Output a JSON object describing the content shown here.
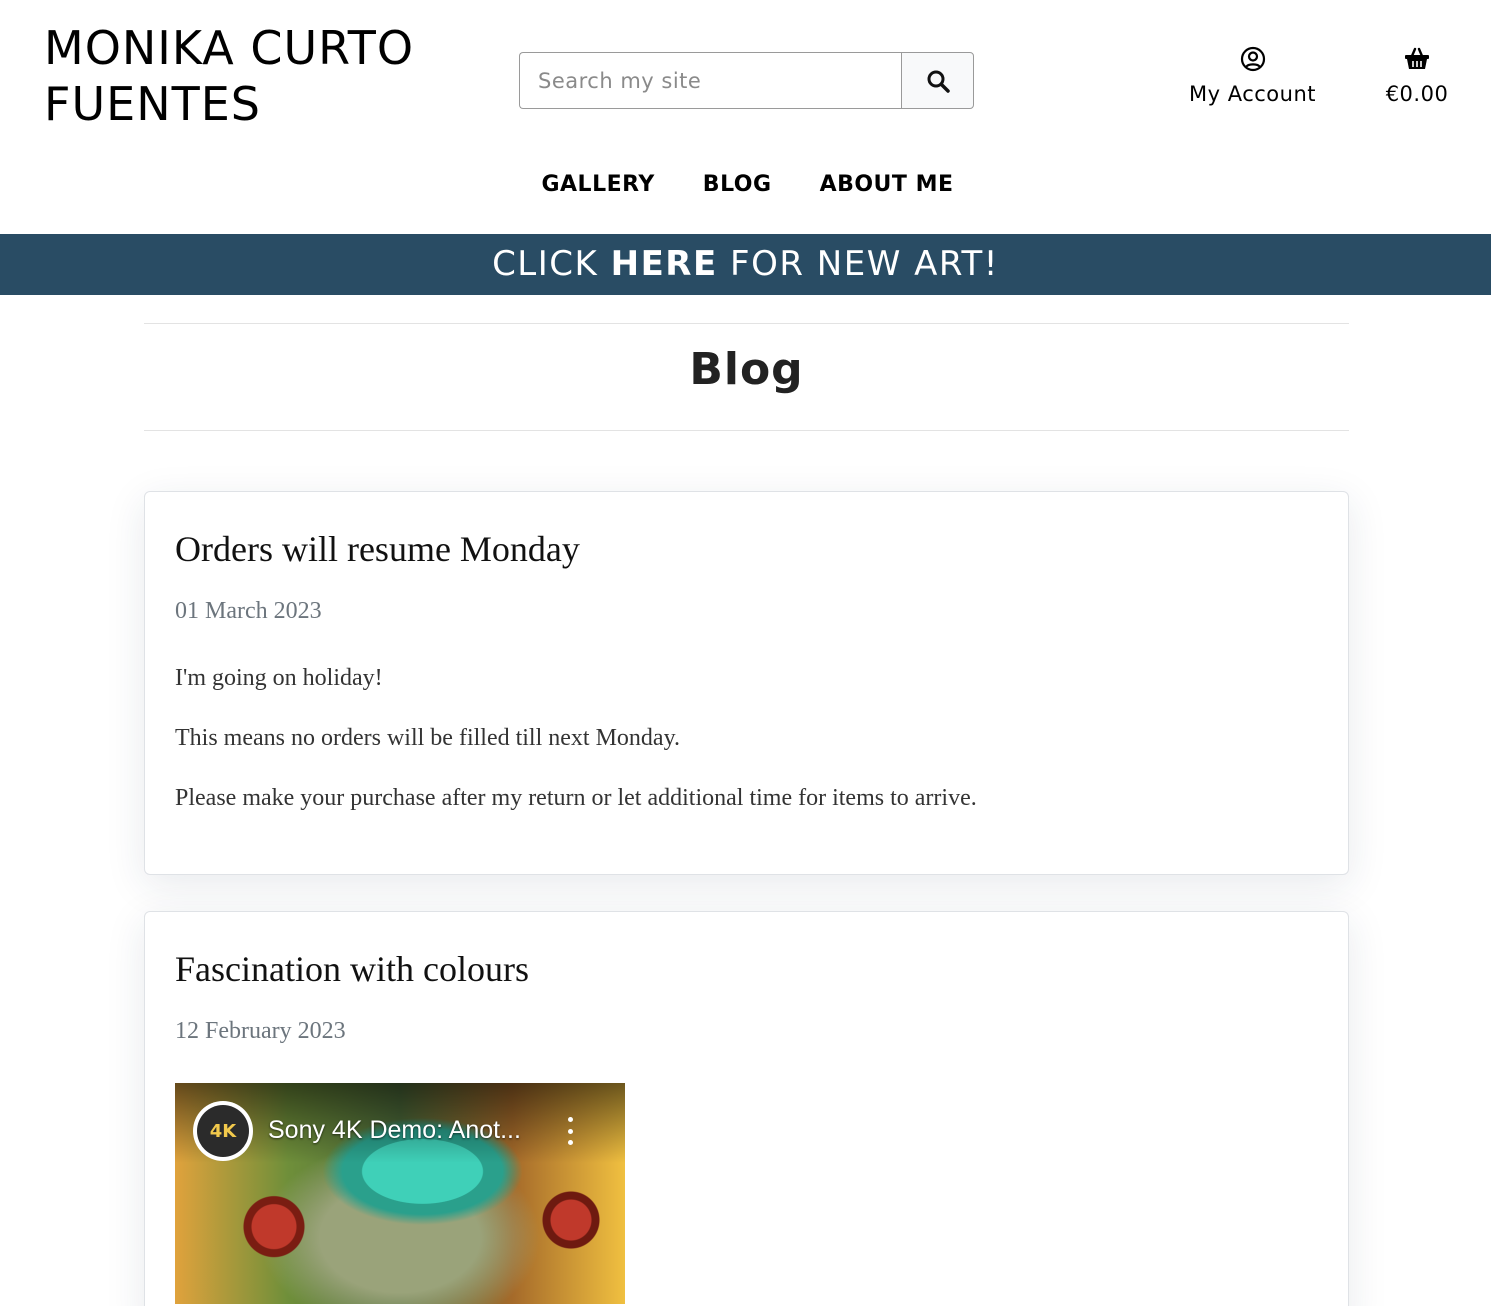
{
  "site": {
    "logo_line1": "MONIKA CURTO",
    "logo_line2": "FUENTES"
  },
  "search": {
    "placeholder": "Search my site",
    "icon": "search-icon"
  },
  "account": {
    "label": "My Account",
    "icon": "user-circle-icon"
  },
  "cart": {
    "total": "€0.00",
    "icon": "basket-icon"
  },
  "nav": {
    "items": [
      "GALLERY",
      "BLOG",
      "ABOUT ME"
    ]
  },
  "banner": {
    "text_before": "CLICK ",
    "text_bold": "HERE",
    "text_after": " FOR NEW ART!",
    "background": "#294c64"
  },
  "page": {
    "title": "Blog"
  },
  "posts": [
    {
      "title": "Orders will resume Monday",
      "date": "01 March 2023",
      "paragraphs": [
        "I'm going on holiday!",
        "This means no orders will be filled till next Monday.",
        "Please make your purchase after my return or let additional time for items to arrive."
      ]
    },
    {
      "title": "Fascination with colours",
      "date": "12 February 2023",
      "video": {
        "title": "Sony 4K Demo: Anot...",
        "channel_badge": "4K"
      }
    }
  ]
}
